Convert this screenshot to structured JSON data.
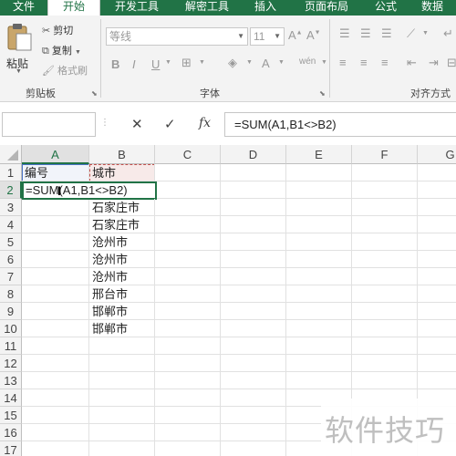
{
  "tabs": [
    "文件",
    "开始",
    "开发工具",
    "解密工具",
    "插入",
    "页面布局",
    "公式",
    "数据"
  ],
  "active_tab": "开始",
  "accent_color": "#217346",
  "clipboard": {
    "paste_label": "粘贴",
    "cut_label": "剪切",
    "copy_label": "复制",
    "format_painter_label": "格式刷",
    "group_label": "剪贴板"
  },
  "font_group": {
    "font_name": "等线",
    "font_size": "11",
    "bold": "B",
    "italic": "I",
    "underline": "U",
    "group_label": "字体",
    "phonetic": "wén"
  },
  "alignment_group": {
    "group_label": "对齐方式"
  },
  "formula_bar": {
    "cancel_icon": "✕",
    "enter_icon": "✓",
    "fx_label": "fx",
    "content": "=SUM(A1,B1<>B2)"
  },
  "columns": [
    "A",
    "B",
    "C",
    "D",
    "E",
    "F",
    "G"
  ],
  "rows": [
    "1",
    "2",
    "3",
    "4",
    "5",
    "6",
    "7",
    "8",
    "9",
    "10",
    "11",
    "12",
    "13",
    "14",
    "15",
    "16",
    "17"
  ],
  "cells": {
    "A1": "编号",
    "B1": "城市",
    "A2": "=SUM(A1,B1<>B2)",
    "B3": "石家庄市",
    "B4": "石家庄市",
    "B5": "沧州市",
    "B6": "沧州市",
    "B7": "沧州市",
    "B8": "邢台市",
    "B9": "邯郸市",
    "B10": "邯郸市"
  },
  "watermark": "软件技巧"
}
